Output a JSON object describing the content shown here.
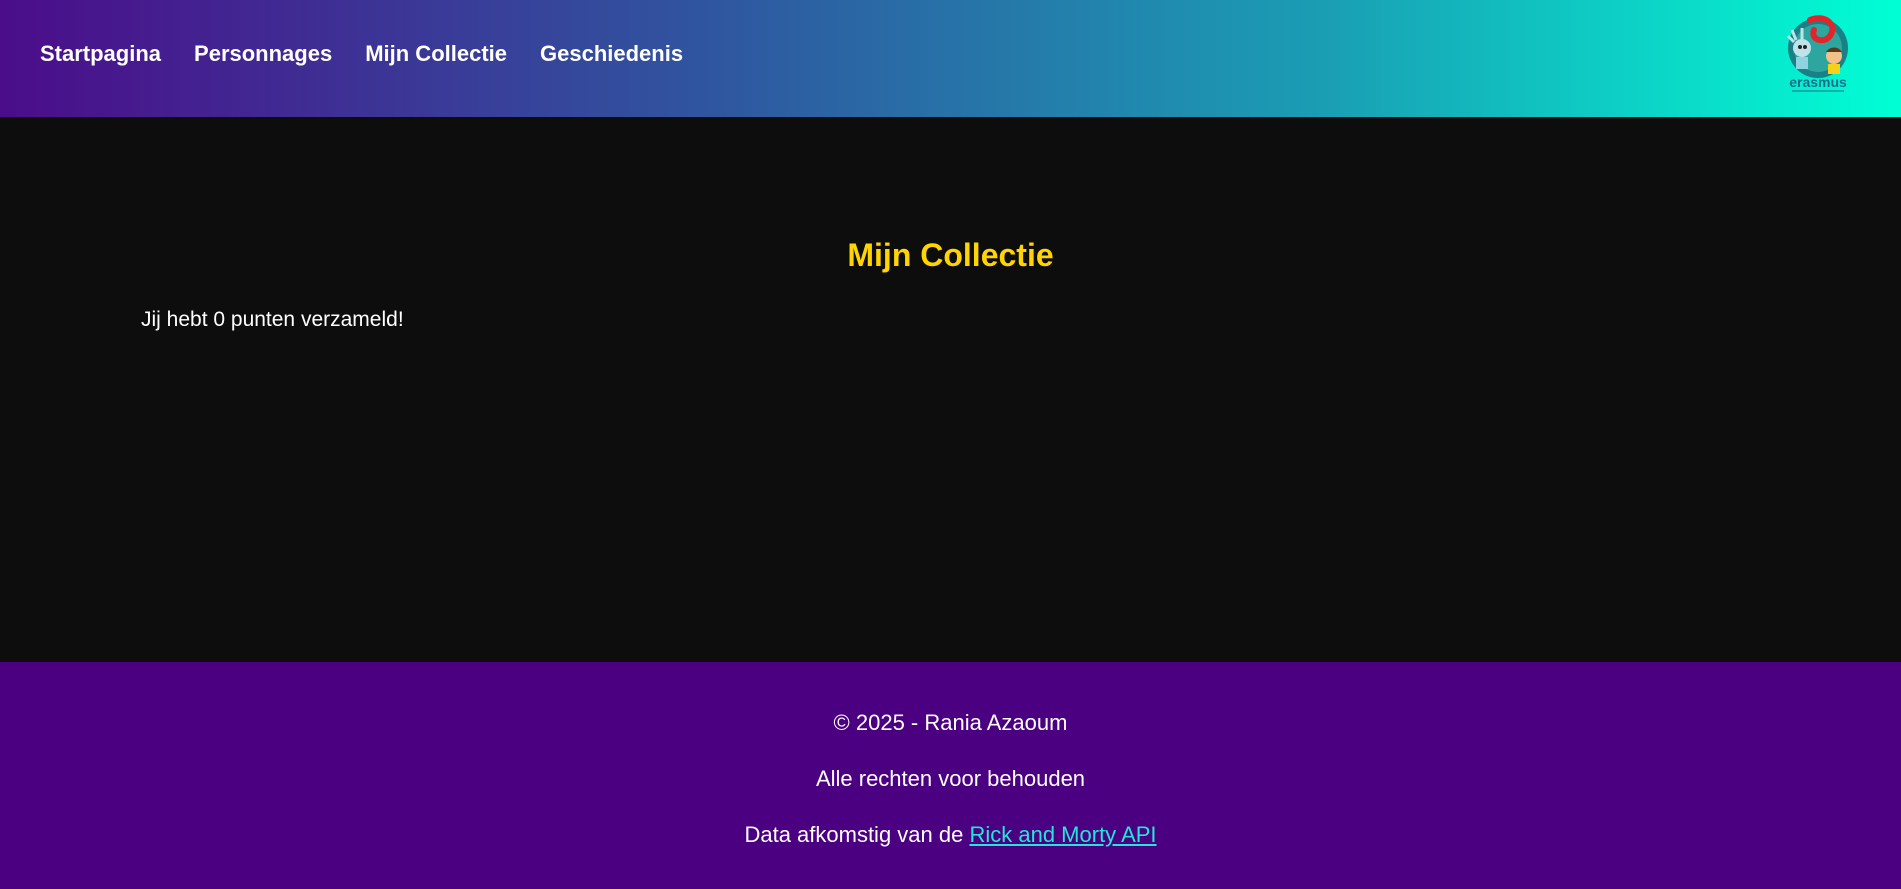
{
  "nav": {
    "items": [
      {
        "label": "Startpagina"
      },
      {
        "label": "Personnages"
      },
      {
        "label": "Mijn Collectie"
      },
      {
        "label": "Geschiedenis"
      }
    ],
    "logo_text": "erasmus"
  },
  "main": {
    "title": "Mijn Collectie",
    "points_message": "Jij hebt 0 punten verzameld!"
  },
  "footer": {
    "copyright": "© 2025 - Rania Azaoum",
    "rights": "Alle rechten voor behouden",
    "source_prefix": "Data afkomstig van de ",
    "source_link": "Rick and Morty API"
  },
  "colors": {
    "title_accent": "#ffd400",
    "footer_bg": "#4b0082",
    "link": "#22e6d8",
    "main_bg": "#0d0d0d"
  }
}
